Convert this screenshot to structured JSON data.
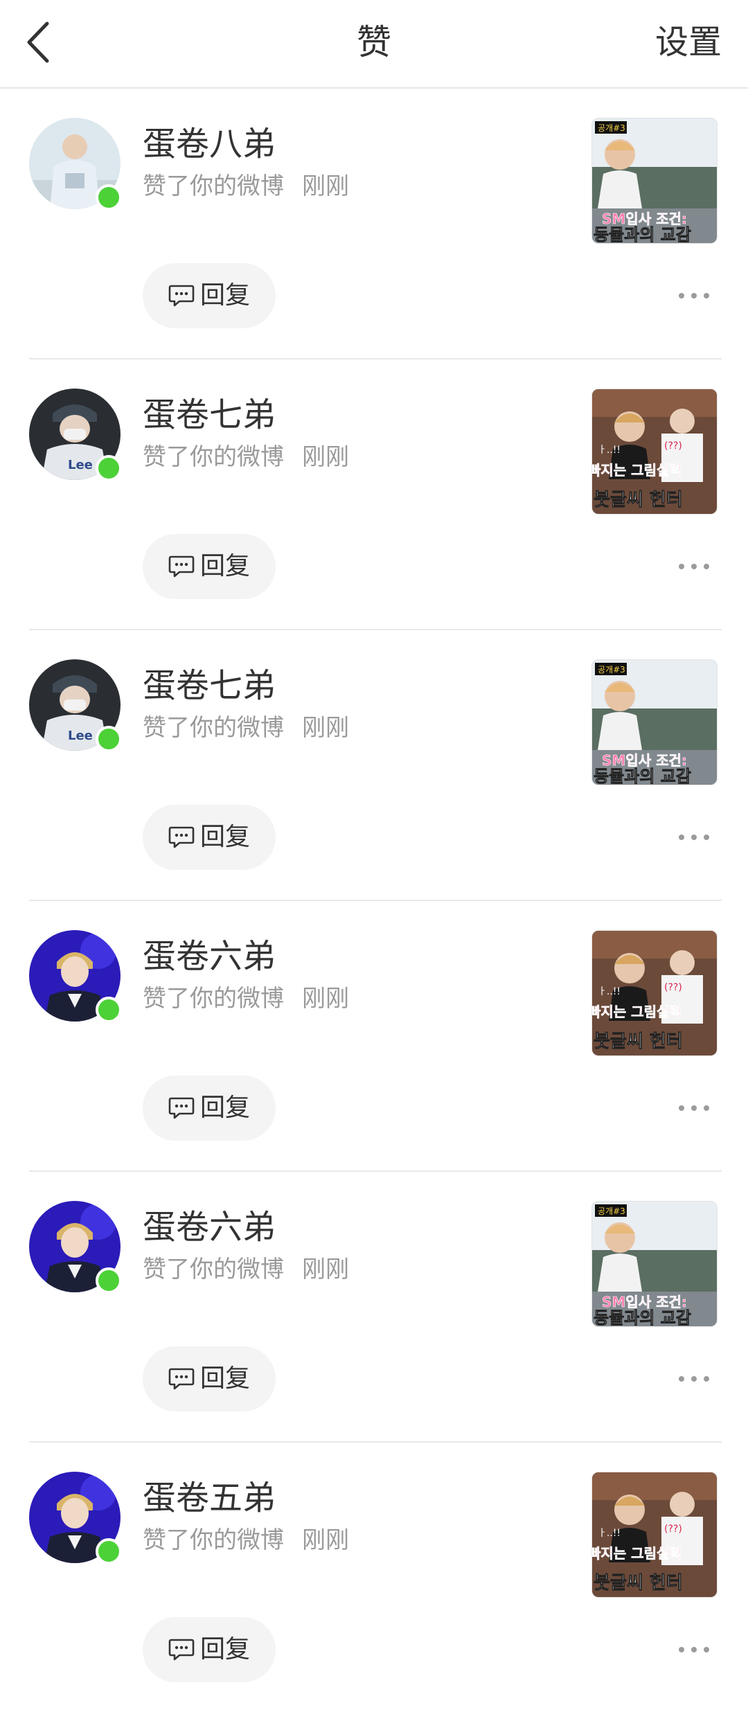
{
  "header": {
    "title": "赞",
    "settings_label": "设置"
  },
  "colors": {
    "online_dot": "#4cd137",
    "meta_text": "#9a9a9a",
    "reply_bg": "#f4f4f4"
  },
  "items": [
    {
      "name": "蛋卷八弟",
      "action": "赞了你的微博",
      "time": "刚刚",
      "reply_label": "回复",
      "avatar": "avatar-1",
      "thumb": "thumb-a",
      "thumb_lines": [
        "SM입사 조건:",
        "동물과의 교감"
      ],
      "thumb_tag": "공개#3"
    },
    {
      "name": "蛋卷七弟",
      "action": "赞了你的微博",
      "time": "刚刚",
      "reply_label": "回复",
      "avatar": "avatar-2",
      "thumb": "thumb-b",
      "thumb_lines": [
        "빠지는 그림실력",
        "붓글씨 헌터"
      ],
      "thumb_tag": ""
    },
    {
      "name": "蛋卷七弟",
      "action": "赞了你的微博",
      "time": "刚刚",
      "reply_label": "回复",
      "avatar": "avatar-2",
      "thumb": "thumb-a",
      "thumb_lines": [
        "SM입사 조건:",
        "동물과의 교감"
      ],
      "thumb_tag": "공개#3"
    },
    {
      "name": "蛋卷六弟",
      "action": "赞了你的微博",
      "time": "刚刚",
      "reply_label": "回复",
      "avatar": "avatar-3",
      "thumb": "thumb-b",
      "thumb_lines": [
        "빠지는 그림실력",
        "붓글씨 헌터"
      ],
      "thumb_tag": ""
    },
    {
      "name": "蛋卷六弟",
      "action": "赞了你的微博",
      "time": "刚刚",
      "reply_label": "回复",
      "avatar": "avatar-3",
      "thumb": "thumb-a",
      "thumb_lines": [
        "SM입사 조건:",
        "동물과의 교감"
      ],
      "thumb_tag": "공개#3"
    },
    {
      "name": "蛋卷五弟",
      "action": "赞了你的微博",
      "time": "刚刚",
      "reply_label": "回复",
      "avatar": "avatar-3",
      "thumb": "thumb-b",
      "thumb_lines": [
        "빠지는 그림실력",
        "붓글씨 헌터"
      ],
      "thumb_tag": ""
    }
  ]
}
